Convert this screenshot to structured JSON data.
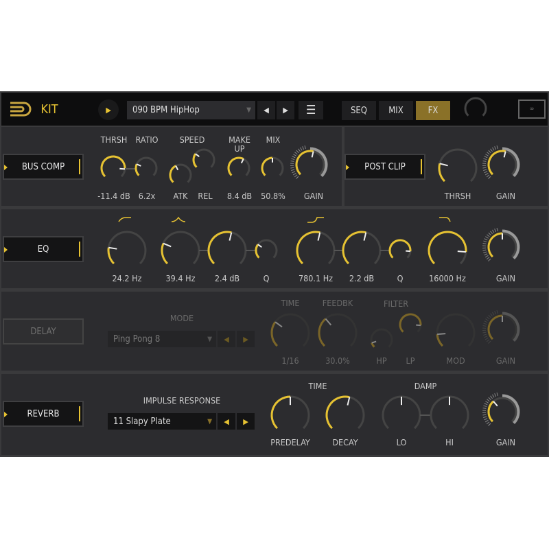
{
  "colors": {
    "accent": "#e6c232",
    "active_tab": "#8a7128",
    "panel": "#2c2c2f"
  },
  "header": {
    "title": "KIT",
    "preset": "090 BPM HipHop",
    "tabs": [
      "SEQ",
      "MIX",
      "FX"
    ],
    "active_tab": "FX",
    "logo": "UVI",
    "master_level": 0.45
  },
  "bus_comp": {
    "label": "BUS COMP",
    "labels": {
      "thrsh": "THRSH",
      "ratio": "RATIO",
      "speed": "SPEED",
      "makeup": "MAKE\nUP",
      "mix": "MIX",
      "gain": "GAIN",
      "atk": "ATK",
      "rel": "REL"
    },
    "values": {
      "thrsh": "-11.4 dB",
      "ratio": "6.2x",
      "makeup": "8.4 dB",
      "mix": "50.8%"
    }
  },
  "post_clip": {
    "label": "POST CLIP",
    "thrsh": "THRSH",
    "gain": "GAIN"
  },
  "eq": {
    "label": "EQ",
    "values": [
      "24.2 Hz",
      "39.4 Hz",
      "2.4 dB",
      "Q",
      "780.1 Hz",
      "2.2 dB",
      "Q",
      "16000 Hz"
    ],
    "gain": "GAIN"
  },
  "delay": {
    "label": "DELAY",
    "mode_label": "MODE",
    "mode": "Ping Pong 8",
    "time": "TIME",
    "feedbk": "FEEDBK",
    "filter": "FILTER",
    "time_value": "1/16",
    "feedbk_value": "30.0%",
    "hp": "HP",
    "lp": "LP",
    "mod": "MOD",
    "gain": "GAIN"
  },
  "reverb": {
    "label": "REVERB",
    "ir_label": "IMPULSE RESPONSE",
    "ir": "11 Slapy Plate",
    "time": "TIME",
    "damp": "DAMP",
    "predelay": "PREDELAY",
    "decay": "DECAY",
    "lo": "LO",
    "hi": "HI",
    "gain": "GAIN"
  },
  "knob_levels": {
    "bc_thrsh": 0.85,
    "bc_ratio": 0.25,
    "bc_atk": 0.4,
    "bc_rel": 0.3,
    "bc_makeup": 0.6,
    "bc_mix": 0.5,
    "bc_gain": 0.55,
    "pc_thrsh": 0.22,
    "pc_gain": 0.55,
    "eq1": 0.2,
    "eq2": 0.25,
    "eq3": 0.55,
    "eq4": 0.3,
    "eq5": 0.55,
    "eq6": 0.55,
    "eq7": 0.85,
    "eq8": 0.85,
    "eq_gain": 0.5,
    "dl_time": 0.3,
    "dl_feedbk": 0.35,
    "dl_hp": 0.1,
    "dl_lp": 0.85,
    "dl_mod": 0.15,
    "dl_gain": 0.5,
    "rv_predelay": 0.5,
    "rv_decay": 0.55,
    "rv_lo": 0.5,
    "rv_hi": 0.5,
    "rv_gain": 0.35
  }
}
